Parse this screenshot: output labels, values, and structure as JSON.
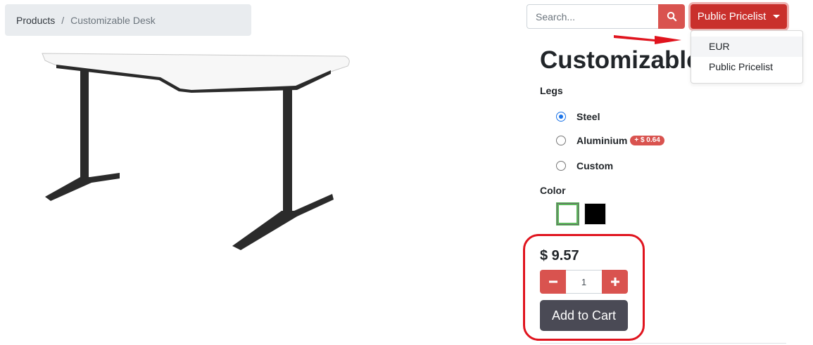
{
  "breadcrumb": {
    "root": "Products",
    "separator": "/",
    "current": "Customizable Desk"
  },
  "search": {
    "placeholder": "Search..."
  },
  "pricelist": {
    "label": "Public Pricelist",
    "options": [
      "EUR",
      "Public Pricelist"
    ]
  },
  "product": {
    "title": "Customizable",
    "legs_label": "Legs",
    "legs_options": [
      {
        "label": "Steel",
        "checked": true
      },
      {
        "label": "Aluminium",
        "extra": "+ $ 0.64",
        "checked": false
      },
      {
        "label": "Custom",
        "checked": false
      }
    ],
    "color_label": "Color",
    "colors": [
      {
        "name": "white",
        "hex": "#ffffff",
        "selected": true
      },
      {
        "name": "black",
        "hex": "#000000",
        "selected": false
      }
    ],
    "price": "$ 9.57",
    "quantity": "1",
    "add_to_cart": "Add to Cart"
  },
  "colors": {
    "accent": "#d9534f",
    "pricelist_button": "#c9302c",
    "cart_button": "#4a4a55",
    "annotation": "#e0141e"
  }
}
